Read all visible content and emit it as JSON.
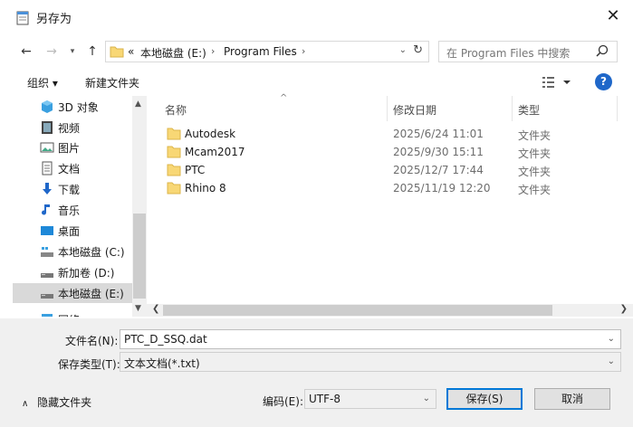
{
  "window": {
    "title": "另存为",
    "close_glyph": "✕"
  },
  "nav": {
    "back": "←",
    "forward": "→",
    "recent": "▾",
    "up": "↑",
    "address": {
      "overflow": "«",
      "drive": "本地磁盘 (E:)",
      "sep": "›",
      "folder": "Program Files",
      "sep2": "›"
    },
    "search_placeholder": "在 Program Files 中搜索"
  },
  "toolbar": {
    "organize": "组织 ▾",
    "new_folder": "新建文件夹",
    "help": "?"
  },
  "sidebar": {
    "items": [
      {
        "label": "3D 对象",
        "icon": "3d-objects-icon"
      },
      {
        "label": "视频",
        "icon": "video-icon"
      },
      {
        "label": "图片",
        "icon": "pictures-icon"
      },
      {
        "label": "文档",
        "icon": "documents-icon"
      },
      {
        "label": "下载",
        "icon": "download-icon"
      },
      {
        "label": "音乐",
        "icon": "music-icon"
      },
      {
        "label": "桌面",
        "icon": "desktop-icon"
      },
      {
        "label": "本地磁盘 (C:)",
        "icon": "system-drive-icon"
      },
      {
        "label": "新加卷 (D:)",
        "icon": "drive-icon"
      },
      {
        "label": "本地磁盘 (E:)",
        "icon": "drive-icon",
        "selected": true
      },
      {
        "label": "网络",
        "icon": "network-icon"
      }
    ]
  },
  "file_list": {
    "columns": [
      "名称",
      "修改日期",
      "类型"
    ],
    "rows": [
      {
        "name": "Autodesk",
        "modified": "2025/6/24 11:01",
        "type": "文件夹"
      },
      {
        "name": "Mcam2017",
        "modified": "2025/9/30 15:11",
        "type": "文件夹"
      },
      {
        "name": "PTC",
        "modified": "2025/12/7 17:44",
        "type": "文件夹"
      },
      {
        "name": "Rhino 8",
        "modified": "2025/11/19 12:20",
        "type": "文件夹"
      }
    ]
  },
  "form": {
    "filename_label": "文件名(N):",
    "filename_value": "PTC_D_SSQ.dat",
    "filetype_label": "保存类型(T):",
    "filetype_value": "文本文档(*.txt)",
    "encoding_label": "编码(E):",
    "encoding_value": "UTF-8",
    "save_label": "保存(S)",
    "cancel_label": "取消",
    "hide_folders_label": "隐藏文件夹"
  },
  "colors": {
    "accent": "#0078d7",
    "folder": "#f8d775",
    "help": "#1f67c9",
    "selected": "#d9d9d9"
  }
}
